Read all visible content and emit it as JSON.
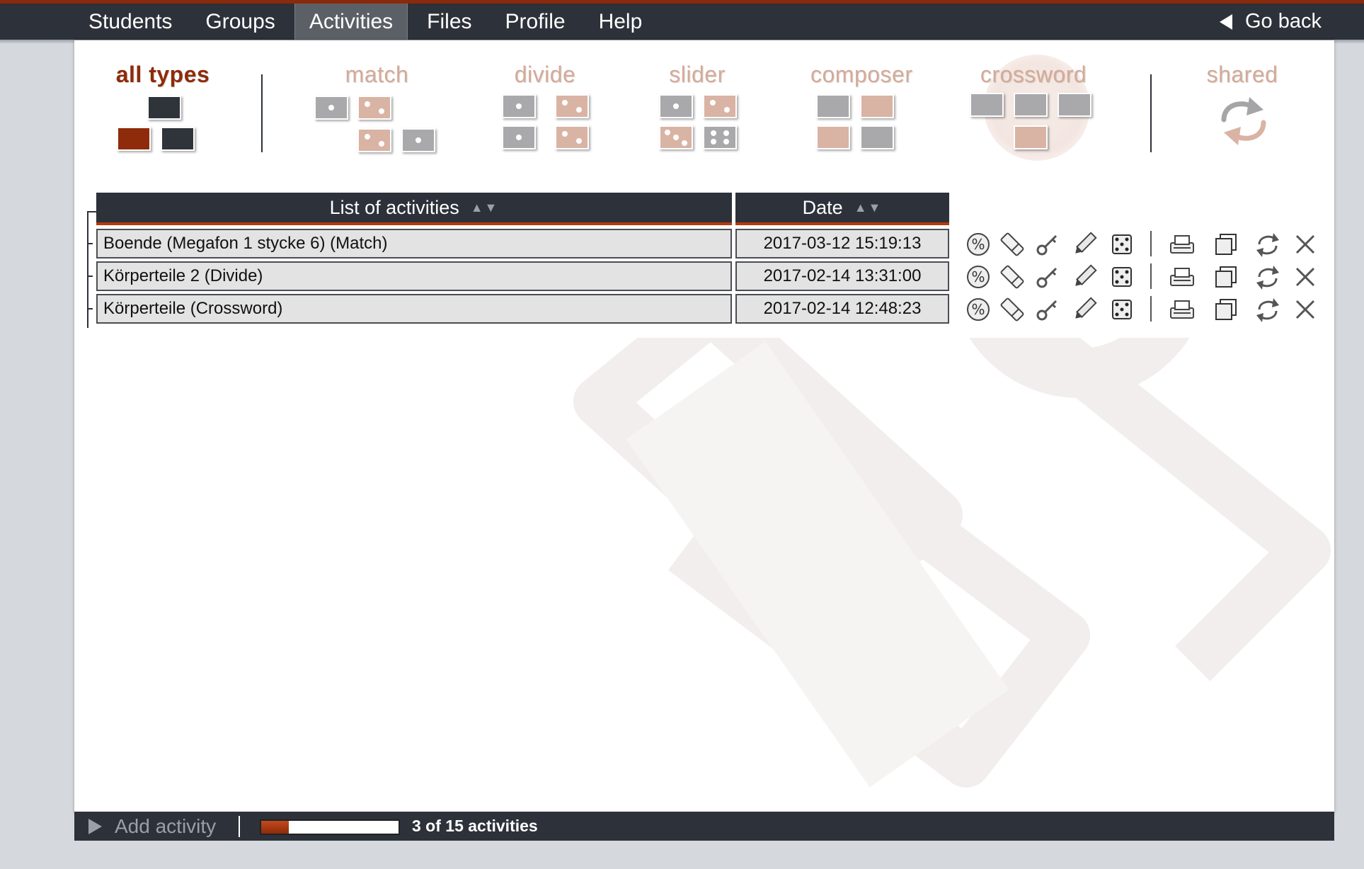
{
  "nav": {
    "items": [
      "Students",
      "Groups",
      "Activities",
      "Files",
      "Profile",
      "Help"
    ],
    "active": "Activities",
    "go_back": "Go back"
  },
  "types": {
    "all": "all types",
    "match": "match",
    "divide": "divide",
    "slider": "slider",
    "composer": "composer",
    "crossword": "crossword",
    "shared": "shared",
    "selected": "all types"
  },
  "table": {
    "col_name": "List of activities",
    "col_date": "Date",
    "sort_glyph": "▲▼",
    "rows": [
      {
        "name": "Boende (Megafon 1 stycke 6) (Match)",
        "date": "2017-03-12 15:19:13"
      },
      {
        "name": "Körperteile 2 (Divide)",
        "date": "2017-02-14 13:31:00"
      },
      {
        "name": "Körperteile (Crossword)",
        "date": "2017-02-14 12:48:23"
      }
    ],
    "row_actions": [
      "percent-icon",
      "eraser-icon",
      "key-icon",
      "pencil-icon",
      "dice-icon",
      "printer-icon",
      "copy-icon",
      "share-icon",
      "delete-icon"
    ]
  },
  "footer": {
    "add_label": "Add activity",
    "progress_fraction": 0.2,
    "count_text": "3 of 15 activities"
  },
  "colors": {
    "accent": "#8e2b0b",
    "dark": "#2d3139",
    "faded": "#d9b3a3"
  }
}
